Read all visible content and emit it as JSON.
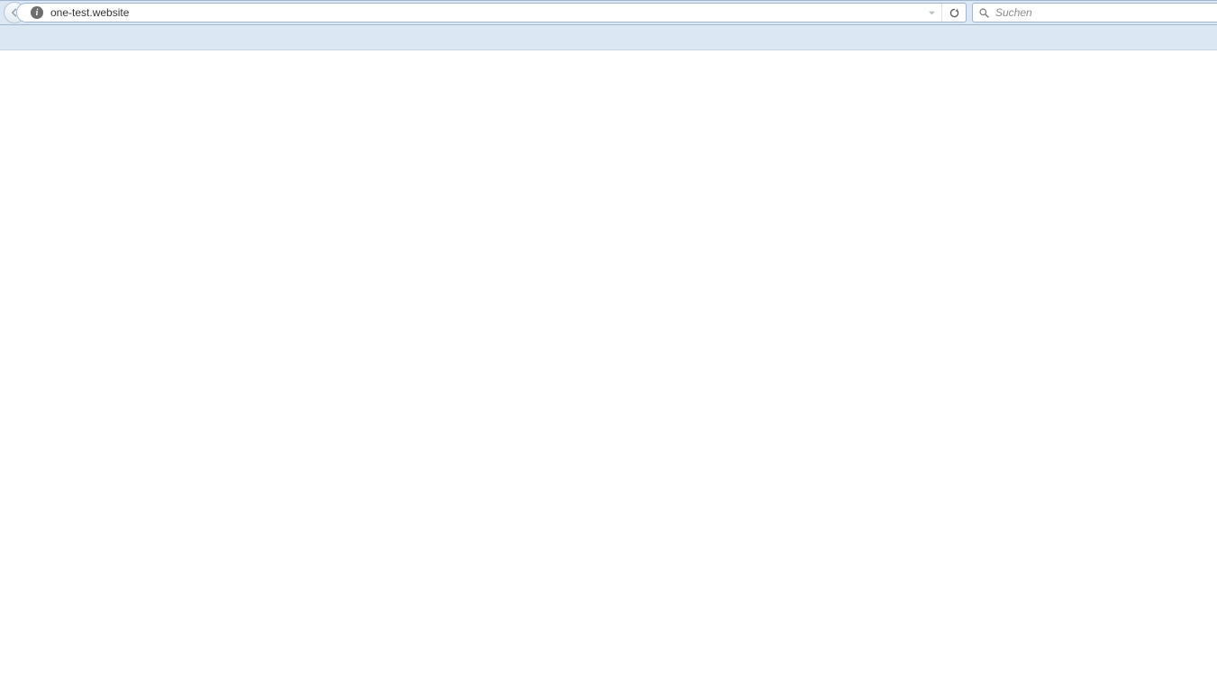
{
  "toolbar": {
    "url": "one-test.website",
    "search_placeholder": "Suchen",
    "info_glyph": "i"
  }
}
